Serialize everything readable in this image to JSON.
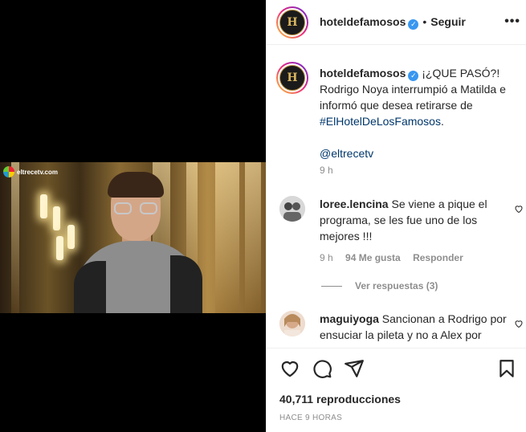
{
  "media": {
    "watermark": "eltrecetv.com"
  },
  "header": {
    "username": "hoteldefamosos",
    "verified_glyph": "✓",
    "separator": "•",
    "follow_label": "Seguir",
    "more_icon": "more-horizontal-icon",
    "avatar_letter": "H"
  },
  "caption": {
    "username": "hoteldefamosos",
    "text_start": "¡¿QUE PASÓ?! Rodrigo Noya interrumpió a Matilda e informó que desea retirarse de ",
    "hashtag": "#ElHotelDeLosFamosos",
    "text_end": ".",
    "mention": "@eltrecetv",
    "time": "9 h"
  },
  "comments": [
    {
      "username": "loree.lencina",
      "text": "Se viene a pique el programa, se les fue uno de los mejores !!!",
      "time": "9 h",
      "likes": "94 Me gusta",
      "reply_label": "Responder",
      "view_replies": "Ver respuestas (3)"
    },
    {
      "username": "maguiyoga",
      "text": "Sancionan a Rodrigo por ensuciar la pileta y no a Alex por"
    }
  ],
  "actions": {
    "views": "40,711 reproducciones",
    "time_ago": "HACE 9 HORAS"
  },
  "colors": {
    "link": "#00376b",
    "verified": "#3897f0",
    "muted": "#8e8e8e",
    "text": "#262626"
  }
}
